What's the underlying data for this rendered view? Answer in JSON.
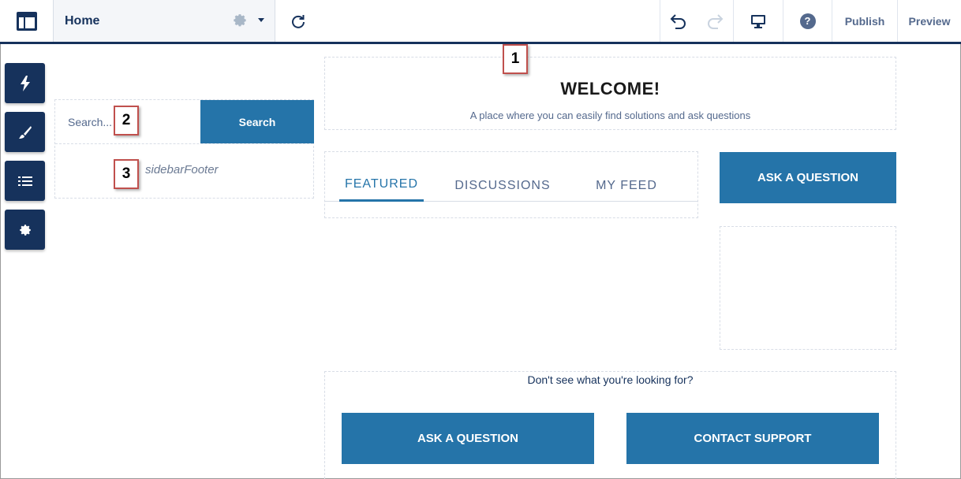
{
  "toolbar": {
    "page_title": "Home",
    "publish_label": "Publish",
    "preview_label": "Preview",
    "help_glyph": "?",
    "icons": [
      "layout-icon",
      "gear-icon",
      "chevron-down-icon",
      "refresh-icon",
      "undo-icon",
      "redo-icon",
      "desktop-icon",
      "help-icon"
    ]
  },
  "rail": {
    "items": [
      "lightning-icon",
      "brush-icon",
      "list-icon",
      "gear-icon"
    ]
  },
  "sidebar": {
    "search_placeholder": "Search...",
    "search_button": "Search",
    "footer_label": "sidebarFooter"
  },
  "welcome": {
    "title": "WELCOME!",
    "subtitle": "A place where you can easily find solutions and ask questions"
  },
  "tabs": [
    {
      "label": "FEATURED",
      "active": true
    },
    {
      "label": "DISCUSSIONS",
      "active": false
    },
    {
      "label": "MY FEED",
      "active": false
    }
  ],
  "ask_question_top": "ASK A QUESTION",
  "cta": {
    "text": "Don't see what you're looking for?",
    "ask_label": "ASK A QUESTION",
    "support_label": "CONTACT SUPPORT"
  },
  "callouts": [
    "1",
    "2",
    "3"
  ],
  "colors": {
    "navy": "#16325c",
    "brand_blue": "#2574a9",
    "callout_border": "#c0504d"
  }
}
